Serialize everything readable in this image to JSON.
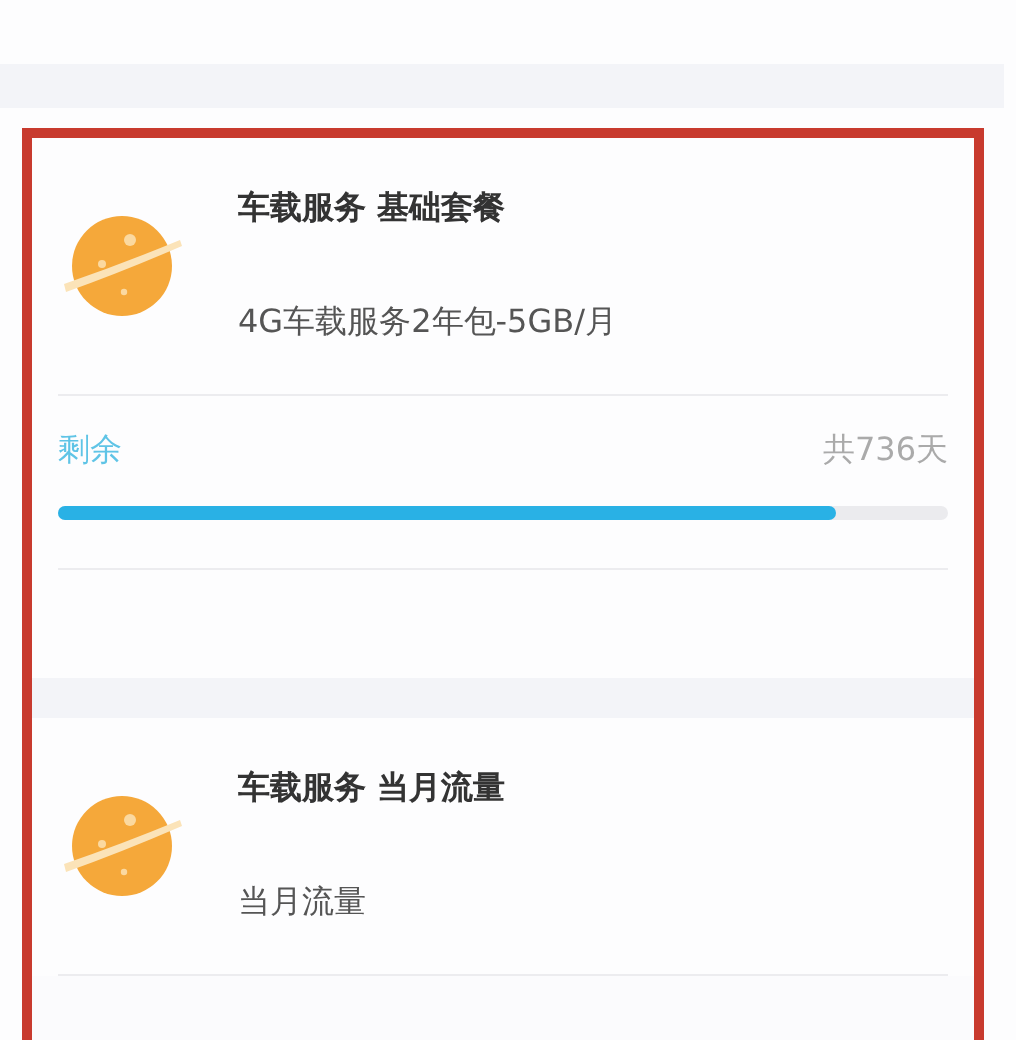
{
  "cards": [
    {
      "title": "车载服务 基础套餐",
      "subtitle": "4G车载服务2年包-5GB/月",
      "remaining_label": "剩余",
      "total": "共736天",
      "level": 0.875
    },
    {
      "title": "车载服务 当月流量",
      "subtitle": "当月流量"
    }
  ]
}
